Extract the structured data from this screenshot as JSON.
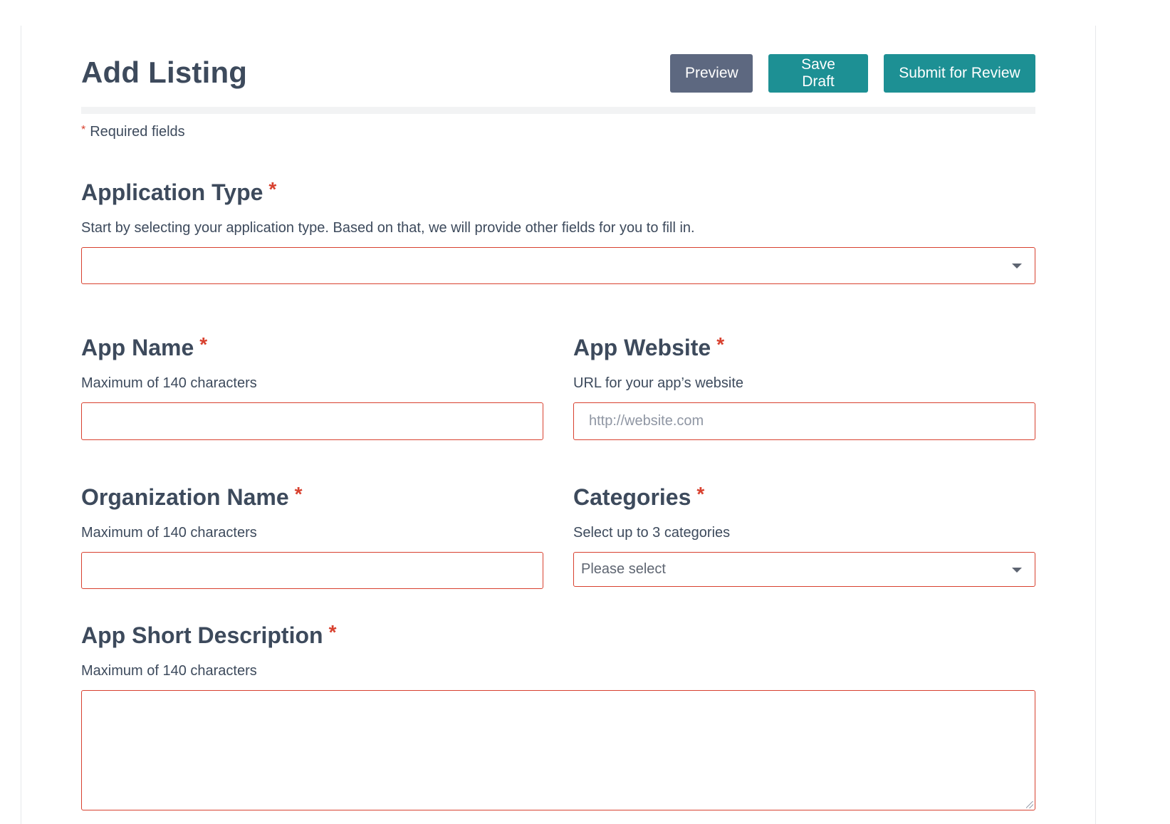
{
  "header": {
    "title": "Add Listing",
    "preview_label": "Preview",
    "save_draft_label": "Save Draft",
    "submit_label": "Submit for Review"
  },
  "required_note": {
    "asterisk": "*",
    "text": "Required fields"
  },
  "fields": {
    "application_type": {
      "label": "Application Type",
      "asterisk": "*",
      "hint": "Start by selecting your application type. Based on that, we will provide other fields for you to fill in.",
      "value": ""
    },
    "app_name": {
      "label": "App Name",
      "asterisk": "*",
      "hint": "Maximum of 140 characters",
      "value": ""
    },
    "app_website": {
      "label": "App Website",
      "asterisk": "*",
      "hint": "URL for your app’s website",
      "placeholder": "http://website.com",
      "value": ""
    },
    "organization_name": {
      "label": "Organization Name",
      "asterisk": "*",
      "hint": "Maximum of 140 characters",
      "value": ""
    },
    "categories": {
      "label": "Categories",
      "asterisk": "*",
      "hint": "Select up to 3 categories",
      "selected": "Please select"
    },
    "short_description": {
      "label": "App Short Description",
      "asterisk": "*",
      "hint": "Maximum of 140 characters",
      "value": ""
    }
  },
  "colors": {
    "text": "#3d4a5c",
    "accent": "#1d9094",
    "secondary_button": "#5d6880",
    "error_border": "#d8412f"
  },
  "icons": {
    "dropdown": "chevron-down-icon",
    "resize": "resize-handle-icon"
  }
}
